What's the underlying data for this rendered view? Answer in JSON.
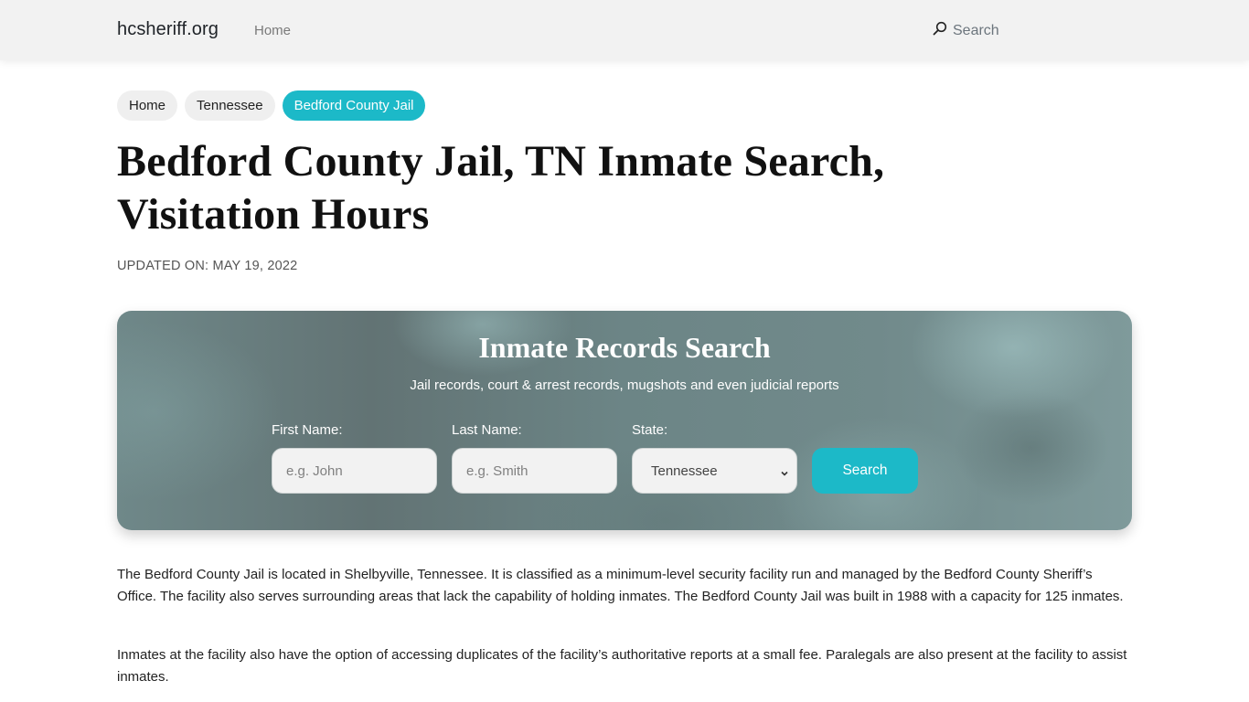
{
  "navbar": {
    "brand": "hcsheriff.org",
    "home_link": "Home",
    "search_label": "Search",
    "search_icon": "search-icon"
  },
  "breadcrumb": [
    {
      "label": "Home",
      "active": false
    },
    {
      "label": "Tennessee",
      "active": false
    },
    {
      "label": "Bedford County Jail",
      "active": true
    }
  ],
  "page": {
    "title": "Bedford County Jail, TN Inmate Search, Visitation Hours",
    "updated": "UPDATED ON: MAY 19, 2022"
  },
  "search_card": {
    "title": "Inmate Records Search",
    "subtitle": "Jail records, court & arrest records, mugshots and even judicial reports",
    "first_name": {
      "label": "First Name:",
      "placeholder": "e.g. John",
      "value": ""
    },
    "last_name": {
      "label": "Last Name:",
      "placeholder": "e.g. Smith",
      "value": ""
    },
    "state": {
      "label": "State:",
      "selected": "Tennessee",
      "icon": "chevron-down-icon"
    },
    "button_label": "Search"
  },
  "content": {
    "paragraphs": [
      "The Bedford County Jail is located in Shelbyville, Tennessee. It is classified as a minimum-level security facility run and managed by the Bedford County Sheriff’s Office. The facility also serves surrounding areas that lack the capability of holding inmates. The Bedford County Jail was built in 1988 with a capacity for 125 inmates.",
      "Inmates at the facility also have the option of accessing duplicates of the facility’s authoritative reports at a small fee. Paralegals are also present at the facility to assist inmates."
    ]
  },
  "colors": {
    "accent": "#1cb9c8",
    "navbar_bg": "#f2f2f2",
    "crumb_bg": "#efefef"
  }
}
